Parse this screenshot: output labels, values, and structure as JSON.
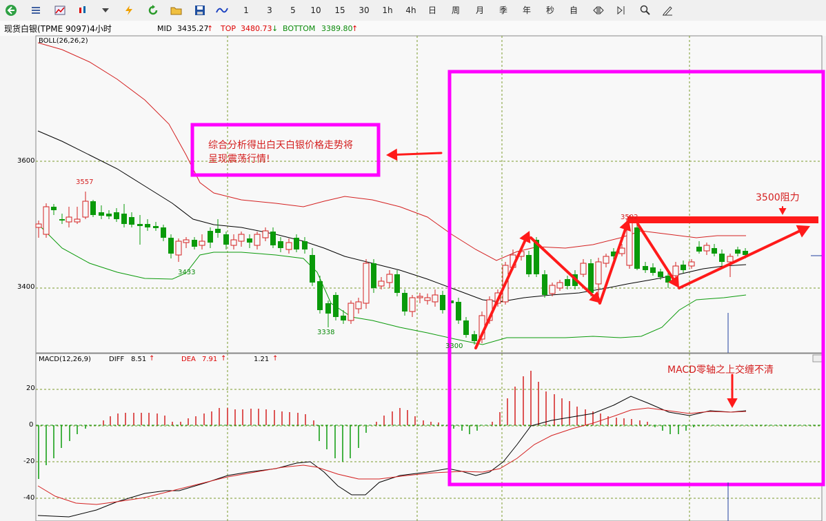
{
  "toolbar": {
    "icons": [
      "back-icon",
      "list-icon",
      "line-chart-icon",
      "candle-icon",
      "dropdown-icon",
      "flash-icon",
      "refresh-icon",
      "folder-icon",
      "save-icon",
      "wave-icon"
    ],
    "periods": [
      "1",
      "3",
      "5",
      "10",
      "15",
      "30",
      "1h",
      "4h",
      "日",
      "周",
      "月",
      "季",
      "年",
      "秒",
      "自"
    ],
    "tools": [
      "left-right-icon",
      "step-icon",
      "search-icon",
      "pen-icon"
    ]
  },
  "info": {
    "symbol": "现货白银(TPME 9097)4小时",
    "mid_label": "MID",
    "mid_value": "3435.27",
    "top_label": "TOP",
    "top_value": "3480.73",
    "bottom_label": "BOTTOM",
    "bottom_value": "3389.80",
    "up_arrow": "↑",
    "down_arrow": "↓"
  },
  "main_panel": {
    "indicator": "BOLL(26,26,2)",
    "y_ticks": [
      "3600",
      "3400"
    ],
    "price_labels": {
      "high": "3557",
      "low1": "3433",
      "low2": "3338",
      "low3": "3300",
      "peak": "3502"
    }
  },
  "macd_panel": {
    "indicator": "MACD(12,26,9)",
    "diff_label": "DIFF",
    "diff_value": "8.51",
    "dea_label": "DEA",
    "dea_value": "7.91",
    "macd_value": "1.21",
    "up_arrow": "↑",
    "y_ticks": [
      "20",
      "0",
      "-20",
      "-40"
    ]
  },
  "annotations": {
    "analysis_line1": "综合分析得出白天白银价格走势将",
    "analysis_line2": "呈现震荡行情!",
    "resistance": "3500阻力",
    "macd_note": "MACD零轴之上交缠不清"
  },
  "colors": {
    "up": "#d42020",
    "down": "#0a9a0a",
    "boll_mid": "#000000",
    "magenta": "#ff00ff",
    "arrow_red": "#ff1a1a",
    "grid": "#7a9a2a"
  }
}
